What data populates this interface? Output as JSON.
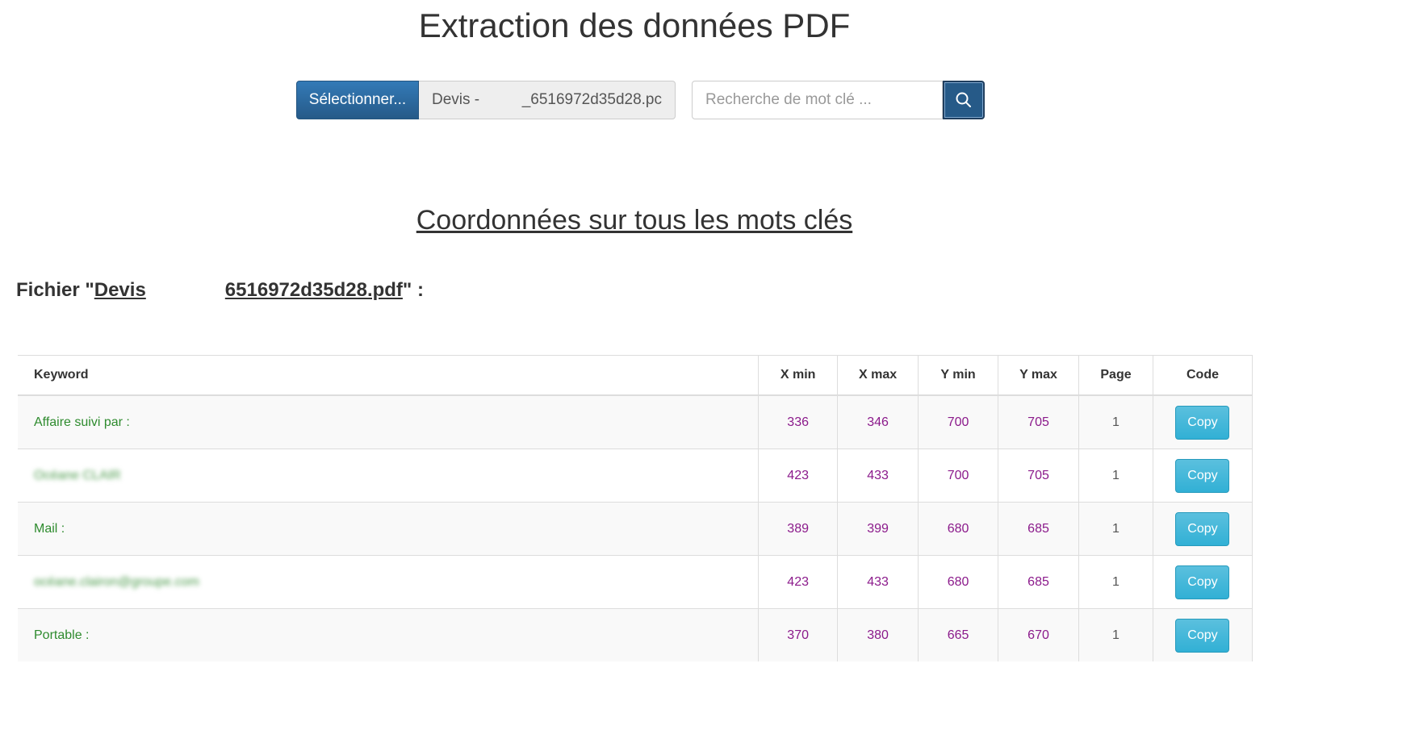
{
  "header": {
    "title": "Extraction des données PDF"
  },
  "toolbar": {
    "select_label": "Sélectionner...",
    "file_name_start": "Devis -",
    "file_name_end": "_6516972d35d28.pc",
    "search_placeholder": "Recherche de mot clé ...",
    "search_icon": "search-icon"
  },
  "section": {
    "title": "Coordonnées sur tous les mots clés"
  },
  "file": {
    "prefix": "Fichier \"",
    "link_start": "Devis",
    "link_end": "6516972d35d28.pdf",
    "suffix": "\" :"
  },
  "table": {
    "headers": [
      "Keyword",
      "X min",
      "X max",
      "Y min",
      "Y max",
      "Page",
      "Code"
    ],
    "rows": [
      {
        "keyword": "Affaire suivi par :",
        "xmin": "336",
        "xmax": "346",
        "ymin": "700",
        "ymax": "705",
        "page": "1",
        "button": "Copy"
      },
      {
        "keyword": "Océane CLAIR",
        "xmin": "423",
        "xmax": "433",
        "ymin": "700",
        "ymax": "705",
        "page": "1",
        "button": "Copy"
      },
      {
        "keyword": "Mail :",
        "xmin": "389",
        "xmax": "399",
        "ymin": "680",
        "ymax": "685",
        "page": "1",
        "button": "Copy"
      },
      {
        "keyword": "océane.clairon@groupe.com",
        "xmin": "423",
        "xmax": "433",
        "ymin": "680",
        "ymax": "685",
        "page": "1",
        "button": "Copy"
      },
      {
        "keyword": "Portable :",
        "xmin": "370",
        "xmax": "380",
        "ymin": "665",
        "ymax": "670",
        "page": "1",
        "button": "Copy"
      }
    ]
  },
  "colors": {
    "primary": "#2e6da4",
    "info_button": "#31b0d5",
    "keyword_text": "#2e8b2e",
    "number_text": "#8b1a8b"
  }
}
